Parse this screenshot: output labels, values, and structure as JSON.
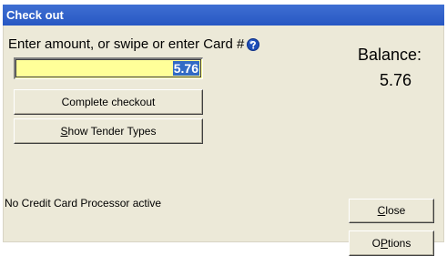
{
  "window": {
    "title": "Check out"
  },
  "prompt": {
    "text": "Enter amount, or swipe or enter Card #",
    "help_icon": "help-question-icon"
  },
  "amount_input": {
    "value": "5.76"
  },
  "buttons": {
    "complete_checkout": "Complete checkout",
    "show_tender_types_underlined": "S",
    "show_tender_types_rest": "how Tender Types",
    "close_underlined": "C",
    "close_rest": "lose",
    "options_prefix": "O",
    "options_underlined": "P",
    "options_rest": "tions"
  },
  "balance": {
    "label": "Balance:",
    "value": "5.76"
  },
  "status": {
    "processor": "No Credit Card Processor active"
  },
  "colors": {
    "title_bar": "#2757c3",
    "dialog_body": "#ece9d8",
    "amount_field": "#ffff99",
    "selection": "#316ac5",
    "help_icon": "#1f4fb8"
  }
}
